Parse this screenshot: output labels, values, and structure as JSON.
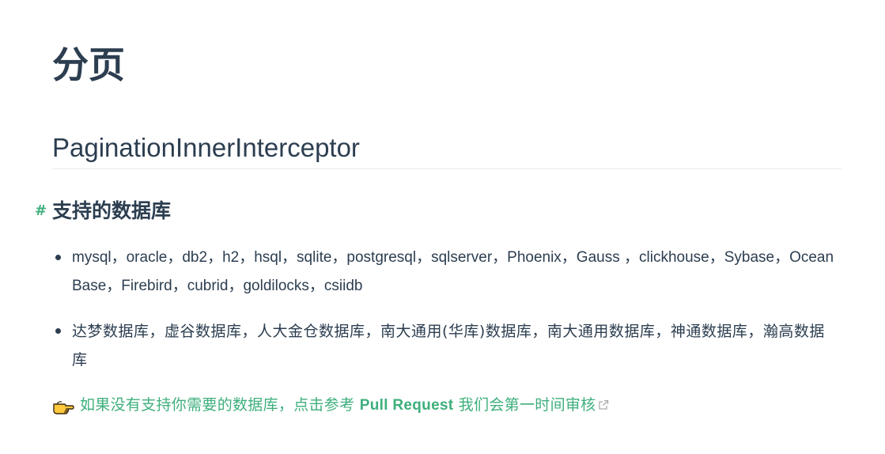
{
  "page": {
    "title": "分页"
  },
  "section": {
    "title": "PaginationInnerInterceptor"
  },
  "subsection": {
    "anchor": "#",
    "title": "支持的数据库"
  },
  "databases": {
    "items": [
      "mysql，oracle，db2，h2，hsql，sqlite，postgresql，sqlserver，Phoenix，Gauss ，clickhouse，Sybase，OceanBase，Firebird，cubrid，goldilocks，csiidb",
      "达梦数据库，虚谷数据库，人大金仓数据库，南大通用(华库)数据库，南大通用数据库，神通数据库，瀚高数据库"
    ]
  },
  "tip": {
    "icon": "pointing-hand-icon",
    "text_before": "如果没有支持你需要的数据库，点击参考 ",
    "link_strong": "Pull Request",
    "text_after": " 我们会第一时间审核",
    "ext_icon": "external-link-icon"
  },
  "colors": {
    "text": "#2c3e50",
    "accent": "#3eaf7c",
    "divider": "#eaecef"
  }
}
